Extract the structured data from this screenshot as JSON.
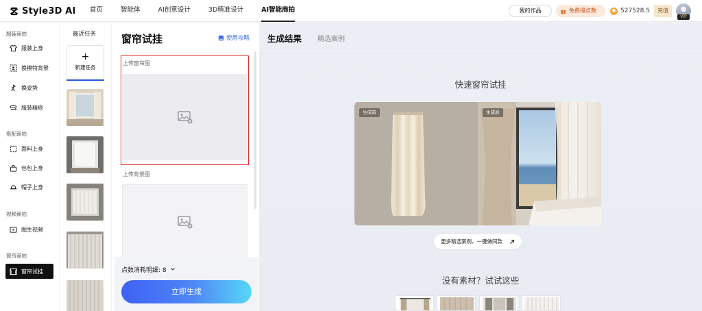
{
  "app": {
    "logo_text": "Style3D AI"
  },
  "nav": {
    "items": [
      {
        "label": "首页"
      },
      {
        "label": "智能体"
      },
      {
        "label": "AI创意设计"
      },
      {
        "label": "3D精准设计"
      },
      {
        "label": "AI智能商拍",
        "active": true
      }
    ]
  },
  "header": {
    "my_works": "我的作品",
    "free_points": "免费得点数",
    "points": "527528.5",
    "coin_symbol": "B",
    "recharge": "充值",
    "vip": "VIP"
  },
  "sidebar": {
    "sections": [
      {
        "title": "服装商拍",
        "items": [
          {
            "label": "服装上身",
            "icon": "tshirt-icon"
          },
          {
            "label": "换模特背景",
            "icon": "swap-background-icon"
          },
          {
            "label": "换姿势",
            "icon": "pose-icon"
          },
          {
            "label": "服装精修",
            "icon": "retouch-icon"
          }
        ]
      },
      {
        "title": "搭配商拍",
        "items": [
          {
            "label": "面料上身",
            "icon": "fabric-icon"
          },
          {
            "label": "包包上身",
            "icon": "bag-icon"
          },
          {
            "label": "帽子上身",
            "icon": "hat-icon"
          }
        ]
      },
      {
        "title": "视频商拍",
        "items": [
          {
            "label": "图生视频",
            "icon": "video-icon"
          }
        ]
      },
      {
        "title": "窗帘商拍",
        "items": [
          {
            "label": "窗帘试挂",
            "icon": "curtain-icon",
            "active": true
          }
        ]
      }
    ]
  },
  "tasks": {
    "title": "最近任务",
    "new_task": "新建任务",
    "plus": "+"
  },
  "upload_panel": {
    "title": "窗帘试挂",
    "guide": "使用攻略",
    "curtain_label": "上传窗帘图",
    "background_label": "上传背景图",
    "cost_label": "点数消耗明细: 8",
    "generate": "立即生成"
  },
  "main": {
    "tab_result": "生成结果",
    "tab_cases": "精选案例",
    "quick_title": "快速窗帘试挂",
    "before_tag": "生成前",
    "after_tag": "生成后",
    "more_cases": "更多精选案例，一键做同款",
    "try_title": "没有素材？试试这些"
  },
  "colors": {
    "accent": "#3f62f4",
    "highlight_border": "#e03030",
    "active_nav": "#111111"
  }
}
